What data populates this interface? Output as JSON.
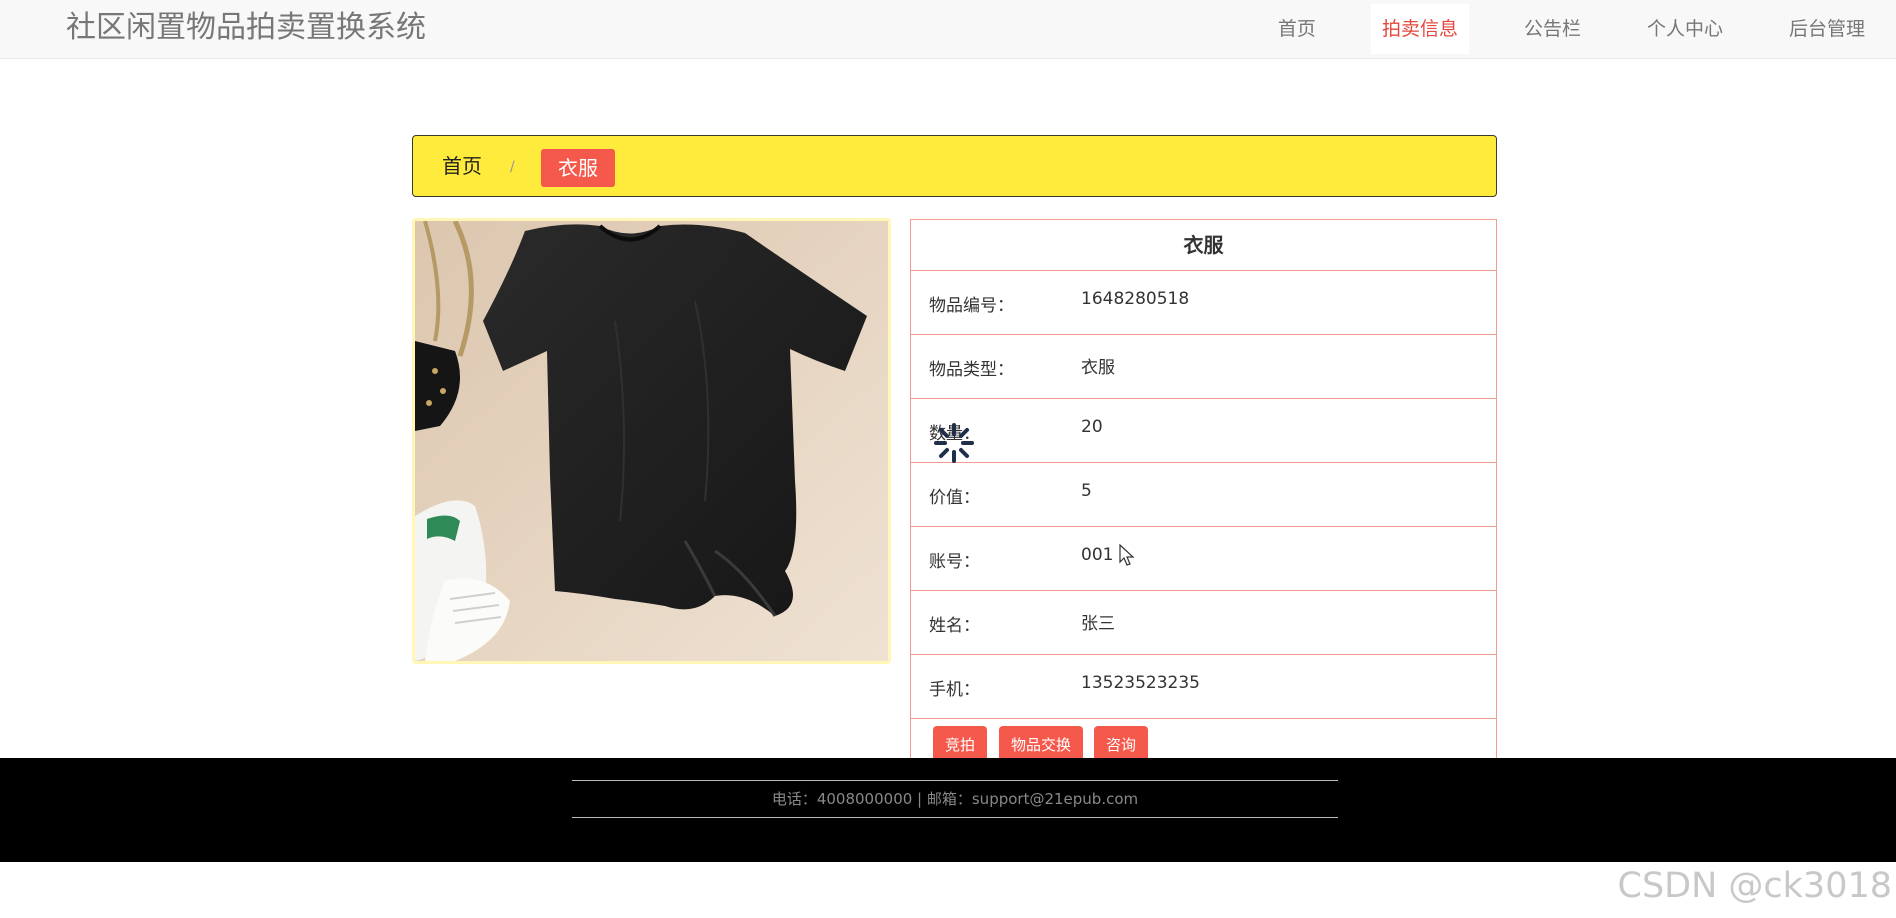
{
  "header": {
    "brand": "社区闲置物品拍卖置换系统",
    "nav": [
      {
        "label": "首页",
        "active": false
      },
      {
        "label": "拍卖信息",
        "active": true
      },
      {
        "label": "公告栏",
        "active": false
      },
      {
        "label": "个人中心",
        "active": false
      },
      {
        "label": "后台管理",
        "active": false
      }
    ]
  },
  "breadcrumb": {
    "home": "首页",
    "separator": "/",
    "current": "衣服"
  },
  "product": {
    "image_icon": "black-tshirt-photo",
    "title": "衣服",
    "fields": [
      {
        "label": "物品编号：",
        "value": "1648280518"
      },
      {
        "label": "物品类型：",
        "value": "衣服"
      },
      {
        "label": "数量：",
        "value": "20"
      },
      {
        "label": "价值：",
        "value": "5"
      },
      {
        "label": "账号：",
        "value": "001"
      },
      {
        "label": "姓名：",
        "value": "张三"
      },
      {
        "label": "手机：",
        "value": "13523523235"
      }
    ],
    "actions": [
      "竞拍",
      "物品交换",
      "咨询"
    ]
  },
  "footer": {
    "contact": "电话：4008000000 | 邮箱：support@21epub.com"
  },
  "watermark": "CSDN @ck3018",
  "colors": {
    "accent": "#f5594c",
    "breadcrumb_bg": "#ffeb3b",
    "table_border": "#f39a8f",
    "footer_bg": "#000000"
  }
}
